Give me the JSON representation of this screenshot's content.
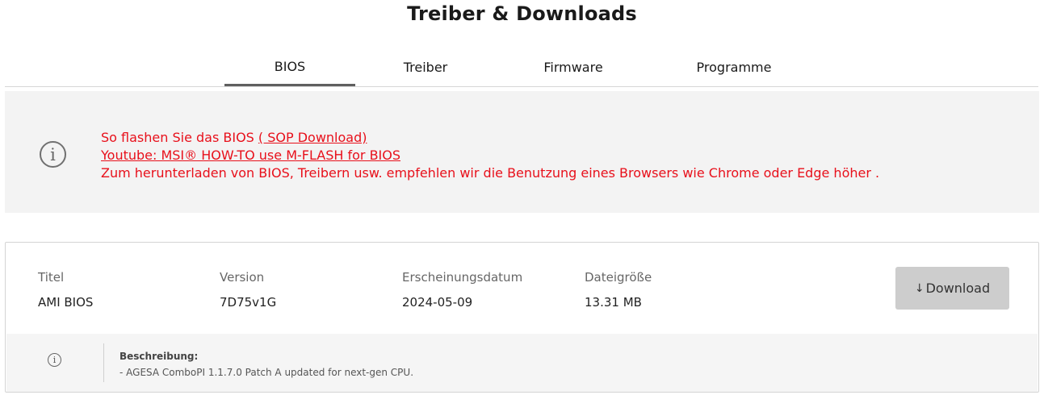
{
  "page": {
    "title": "Treiber & Downloads"
  },
  "tabs": [
    {
      "label": "BIOS",
      "active": true
    },
    {
      "label": "Treiber",
      "active": false
    },
    {
      "label": "Firmware",
      "active": false
    },
    {
      "label": "Programme",
      "active": false
    }
  ],
  "notice": {
    "icon": "info-icon",
    "line1_text": "So flashen Sie das BIOS ",
    "line1_link": "( SOP Download)",
    "line2_link": "Youtube: MSI® HOW-TO use M-FLASH for BIOS",
    "line3_text": "Zum herunterladen von BIOS, Treibern usw. empfehlen wir die Benutzung eines Browsers wie Chrome oder Edge höher .",
    "color": "#e8101b"
  },
  "item": {
    "columns": [
      {
        "label": "Titel",
        "value": "AMI BIOS"
      },
      {
        "label": "Version",
        "value": "7D75v1G"
      },
      {
        "label": "Erscheinungsdatum",
        "value": "2024-05-09"
      },
      {
        "label": "Dateigröße",
        "value": "13.31 MB"
      }
    ],
    "download_icon": "download-arrow-icon",
    "download_arrow": "↓",
    "download_label": "Download",
    "description": {
      "icon": "info-icon",
      "title": "Beschreibung:",
      "body": "- AGESA ComboPI 1.1.7.0 Patch A updated for next-gen CPU."
    }
  }
}
